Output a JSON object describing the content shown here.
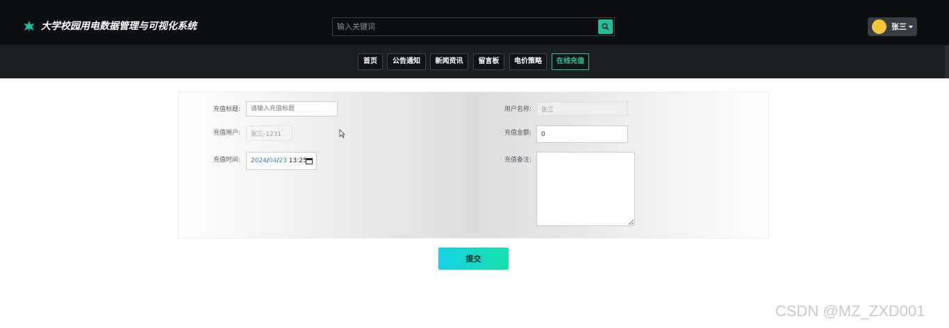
{
  "header": {
    "app_title": "大学校园用电数据管理与可视化系统",
    "search_placeholder": "输入关键词",
    "user_name": "张三"
  },
  "nav": {
    "items": [
      {
        "label": "首页",
        "active": false
      },
      {
        "label": "公告通知",
        "active": false
      },
      {
        "label": "新闻资讯",
        "active": false
      },
      {
        "label": "留言板",
        "active": false
      },
      {
        "label": "电价策略",
        "active": false
      },
      {
        "label": "在线充值",
        "active": true
      }
    ]
  },
  "form": {
    "title_label": "充值标题:",
    "title_placeholder": "请输入充值标题",
    "recharge_user_label": "充值用户:",
    "recharge_user_value": "张三-1231",
    "recharge_time_label": "充值时间:",
    "date_year": "2024",
    "date_month": "04",
    "date_day": "23",
    "date_time": "13:25",
    "username_label": "用户名称:",
    "username_value": "张三",
    "amount_label": "充值金额:",
    "amount_value": "0",
    "remark_label": "充值备注:",
    "remark_value": ""
  },
  "submit_label": "提交",
  "watermark": "CSDN @MZ_ZXD001",
  "colors": {
    "accent": "#27c88e",
    "topbar": "#0c0e11",
    "navbar": "#1b1e22"
  }
}
